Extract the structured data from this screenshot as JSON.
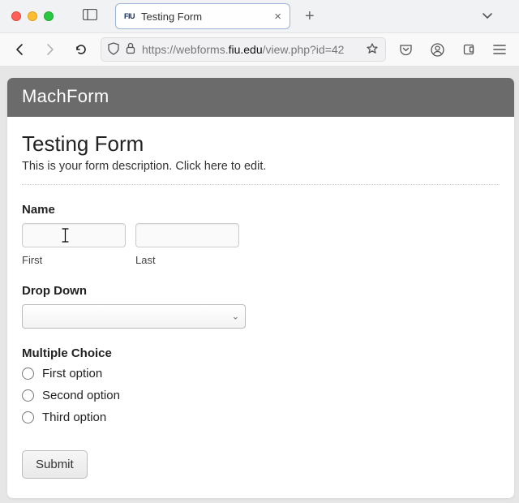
{
  "browser": {
    "tab": {
      "favicon": "FIU",
      "title": "Testing Form"
    },
    "url": {
      "prefix": "https://webforms.",
      "domain": "fiu.edu",
      "suffix": "/view.php?id=42"
    }
  },
  "page": {
    "brand": "MachForm",
    "title": "Testing Form",
    "description": "This is your form description. Click here to edit."
  },
  "fields": {
    "name": {
      "label": "Name",
      "first_sublabel": "First",
      "last_sublabel": "Last",
      "first_value": "",
      "last_value": ""
    },
    "dropdown": {
      "label": "Drop Down",
      "selected": ""
    },
    "multiple_choice": {
      "label": "Multiple Choice",
      "options": [
        "First option",
        "Second option",
        "Third option"
      ]
    }
  },
  "buttons": {
    "submit": "Submit"
  }
}
